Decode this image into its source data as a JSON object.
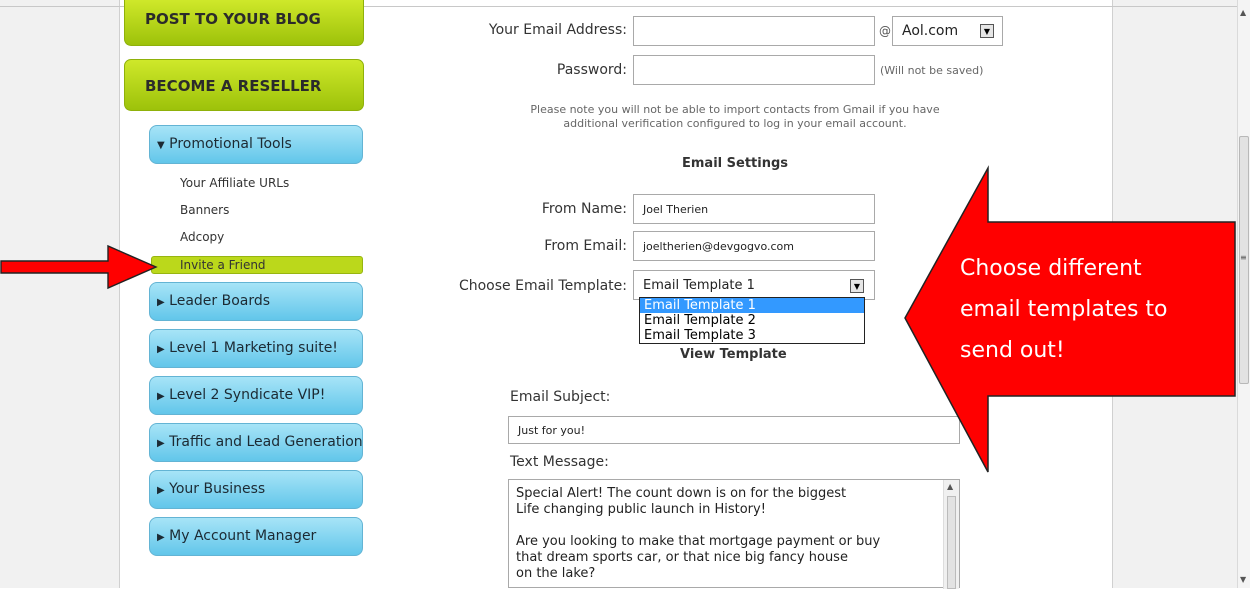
{
  "sidebar": {
    "post_blog": "POST TO YOUR BLOG",
    "reseller": "BECOME A RESELLER",
    "menu": [
      {
        "label": "Promotional Tools",
        "expanded": true
      },
      {
        "label": "Leader Boards"
      },
      {
        "label": "Level 1 Marketing suite!"
      },
      {
        "label": "Level 2 Syndicate VIP!"
      },
      {
        "label": "Traffic and Lead Generation"
      },
      {
        "label": "Your Business"
      },
      {
        "label": "My Account Manager"
      }
    ],
    "submenu": [
      "Your Affiliate URLs",
      "Banners",
      "Adcopy",
      "Invite a Friend"
    ]
  },
  "form": {
    "email_label": "Your Email Address:",
    "email_value": "",
    "at": "@",
    "domain": "Aol.com",
    "password_label": "Password:",
    "password_note": "(Will not be saved)",
    "gmail_note_1": "Please note you will not be able to import contacts from Gmail if you have",
    "gmail_note_2": "additional verification configured to log in your email account.",
    "settings_heading": "Email Settings",
    "from_name_label": "From Name:",
    "from_name_value": "Joel Therien",
    "from_email_label": "From Email:",
    "from_email_value": "joeltherien@devgogvo.com",
    "template_label": "Choose Email Template:",
    "template_selected": "Email Template 1",
    "template_options": [
      "Email Template 1",
      "Email Template 2",
      "Email Template 3"
    ],
    "view_template": "View Template",
    "subject_label": "Email Subject:",
    "subject_value": "Just for you!",
    "message_label": "Text Message:",
    "message_lines": [
      "Special Alert! The count down is on for the biggest",
      "Life changing public launch in History!",
      "",
      "Are you looking to make that mortgage payment or buy",
      "that dream sports car, or that nice big fancy house",
      "on the lake?"
    ]
  },
  "callout": {
    "lines": [
      "Choose different",
      "email templates to",
      "send out!"
    ],
    "color": "#ff0000"
  },
  "colors": {
    "green_button": "#b5d51a",
    "blue_menu": "#7fd3f0",
    "highlight": "#bbd81b",
    "selection": "#3399ff",
    "arrow_red": "#ff0000"
  }
}
